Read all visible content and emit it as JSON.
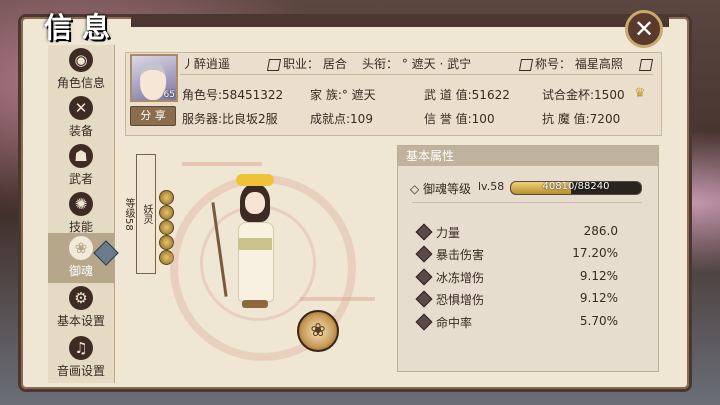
{
  "window": {
    "title": "信息"
  },
  "sidebar": {
    "items": [
      {
        "label": "角色信息",
        "icon": "role-icon",
        "glyph": "◉",
        "active": false
      },
      {
        "label": "装备",
        "icon": "swords-icon",
        "glyph": "✕",
        "active": false
      },
      {
        "label": "武者",
        "icon": "warrior-icon",
        "glyph": "☗",
        "active": false
      },
      {
        "label": "技能",
        "icon": "skill-icon",
        "glyph": "✺",
        "active": false
      },
      {
        "label": "御魂",
        "icon": "soul-icon",
        "glyph": "❀",
        "active": true
      },
      {
        "label": "基本设置",
        "icon": "gear-icon",
        "glyph": "⚙",
        "active": false
      },
      {
        "label": "音画设置",
        "icon": "music-icon",
        "glyph": "♫",
        "active": false
      }
    ]
  },
  "profile": {
    "name": "丿醉逍遥",
    "avatar_level": "65",
    "share_label": "分 享",
    "job": "职业：  居合",
    "title": "头衔：  ° 遮天 · 武宁",
    "honor": "称号：  福星高照",
    "role_id": "角色号:58451322",
    "family": "家    族:° 遮天",
    "force_value": "武 道 值:51622",
    "trial": "试合金杯:1500",
    "server": "服务器:比良坂2服",
    "achievement": "成就点:109",
    "credit": "信 誉 值:100",
    "demon_resist": "抗 魔 值:7200"
  },
  "spirit": {
    "side_label_top": "妖灵",
    "side_label_bottom": "等级58",
    "slots": 5
  },
  "attributes": {
    "panel_title": "基本属性",
    "soul_level_label": "御魂等级",
    "soul_level": "lv.58",
    "exp_text": "40810/88240",
    "exp_progress": 0.4625,
    "rows": [
      {
        "name": "力量",
        "value": "286.0"
      },
      {
        "name": "暴击伤害",
        "value": "17.20%"
      },
      {
        "name": "冰冻增伤",
        "value": "9.12%"
      },
      {
        "name": "恐惧增伤",
        "value": "9.12%"
      },
      {
        "name": "命中率",
        "value": "5.70%"
      }
    ]
  }
}
